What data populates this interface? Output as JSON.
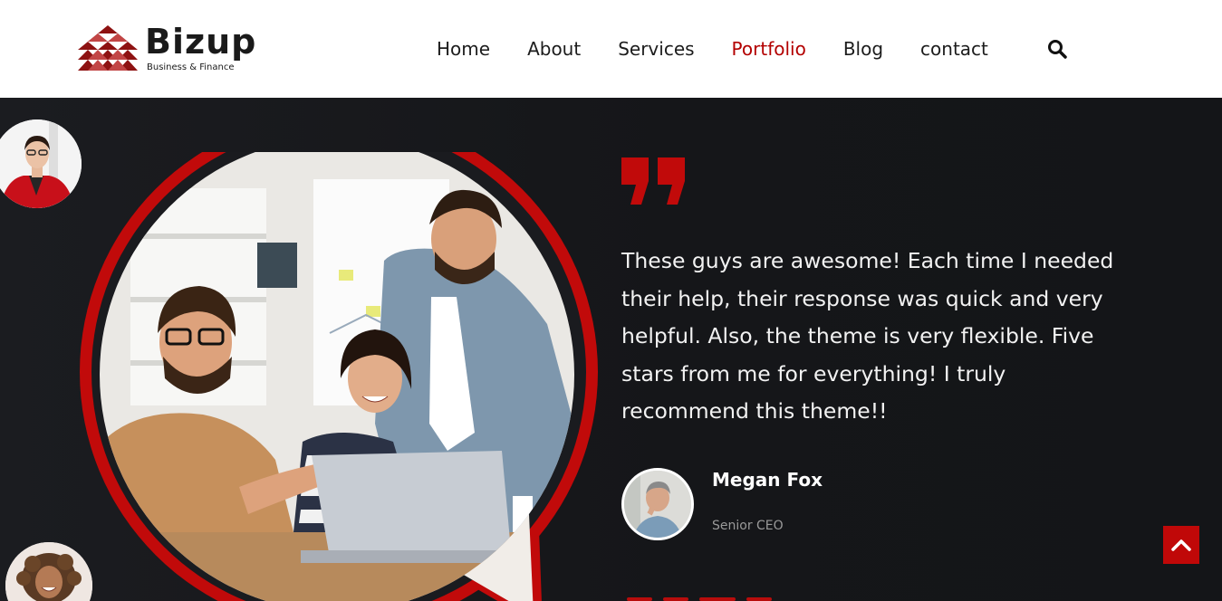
{
  "brand": {
    "name": "Bizup",
    "tagline": "Business & Finance"
  },
  "nav": {
    "items": [
      {
        "label": "Home"
      },
      {
        "label": "About"
      },
      {
        "label": "Services"
      },
      {
        "label": "Portfolio",
        "active": true
      },
      {
        "label": "Blog"
      },
      {
        "label": "contact"
      }
    ],
    "search_icon": "search-icon"
  },
  "testimonial": {
    "quote_icon": "quote-icon",
    "text": "These guys are awesome! Each time I needed their help, their response was quick and very helpful. Also, the theme is very flexible. Five stars from me for everything! I truly recommend this theme!!",
    "author": {
      "name": "Megan Fox",
      "role": "Senior CEO"
    }
  },
  "scroll_top_icon": "chevron-up-icon",
  "colors": {
    "accent": "#c00808",
    "nav_active": "#b30000",
    "background": "#16171b",
    "header": "#ffffff"
  }
}
